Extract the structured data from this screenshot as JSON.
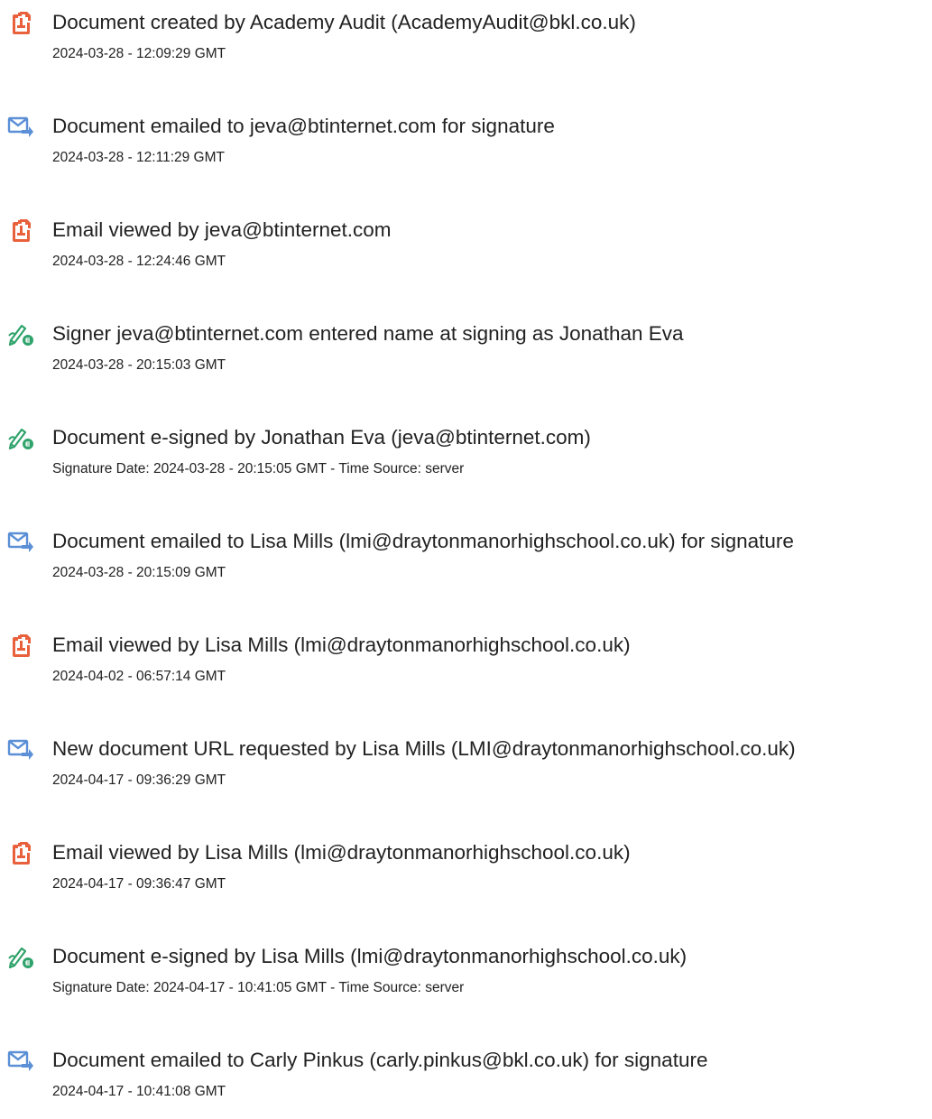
{
  "entries": [
    {
      "icon": "document-icon",
      "title": "Document created by Academy Audit (AcademyAudit@bkl.co.uk)",
      "detail": "2024-03-28 - 12:09:29 GMT"
    },
    {
      "icon": "email-icon",
      "title": "Document emailed to jeva@btinternet.com for signature",
      "detail": "2024-03-28 - 12:11:29 GMT"
    },
    {
      "icon": "document-icon",
      "title": "Email viewed by jeva@btinternet.com",
      "detail": "2024-03-28 - 12:24:46 GMT"
    },
    {
      "icon": "esign-pen-icon",
      "title": "Signer jeva@btinternet.com entered name at signing as Jonathan Eva",
      "detail": "2024-03-28 - 20:15:03 GMT"
    },
    {
      "icon": "esign-pen-icon",
      "title": "Document e-signed by Jonathan Eva (jeva@btinternet.com)",
      "detail": "Signature Date: 2024-03-28 - 20:15:05 GMT - Time Source: server"
    },
    {
      "icon": "email-icon",
      "title": "Document emailed to Lisa Mills (lmi@draytonmanorhighschool.co.uk) for signature",
      "detail": "2024-03-28 - 20:15:09 GMT"
    },
    {
      "icon": "document-icon",
      "title": "Email viewed by Lisa Mills (lmi@draytonmanorhighschool.co.uk)",
      "detail": "2024-04-02 - 06:57:14 GMT"
    },
    {
      "icon": "email-icon",
      "title": "New document URL requested by Lisa Mills (LMI@draytonmanorhighschool.co.uk)",
      "detail": "2024-04-17 - 09:36:29 GMT"
    },
    {
      "icon": "document-icon",
      "title": "Email viewed by Lisa Mills (lmi@draytonmanorhighschool.co.uk)",
      "detail": "2024-04-17 - 09:36:47 GMT"
    },
    {
      "icon": "esign-pen-icon",
      "title": "Document e-signed by Lisa Mills (lmi@draytonmanorhighschool.co.uk)",
      "detail": "Signature Date: 2024-04-17 - 10:41:05 GMT - Time Source: server"
    },
    {
      "icon": "email-icon",
      "title": "Document emailed to Carly Pinkus (carly.pinkus@bkl.co.uk) for signature",
      "detail": "2024-04-17 - 10:41:08 GMT"
    }
  ],
  "colors": {
    "document_icon": "#e8613c",
    "email_icon": "#5b8fd6",
    "esign_icon": "#2fa36b",
    "text": "#222222"
  }
}
